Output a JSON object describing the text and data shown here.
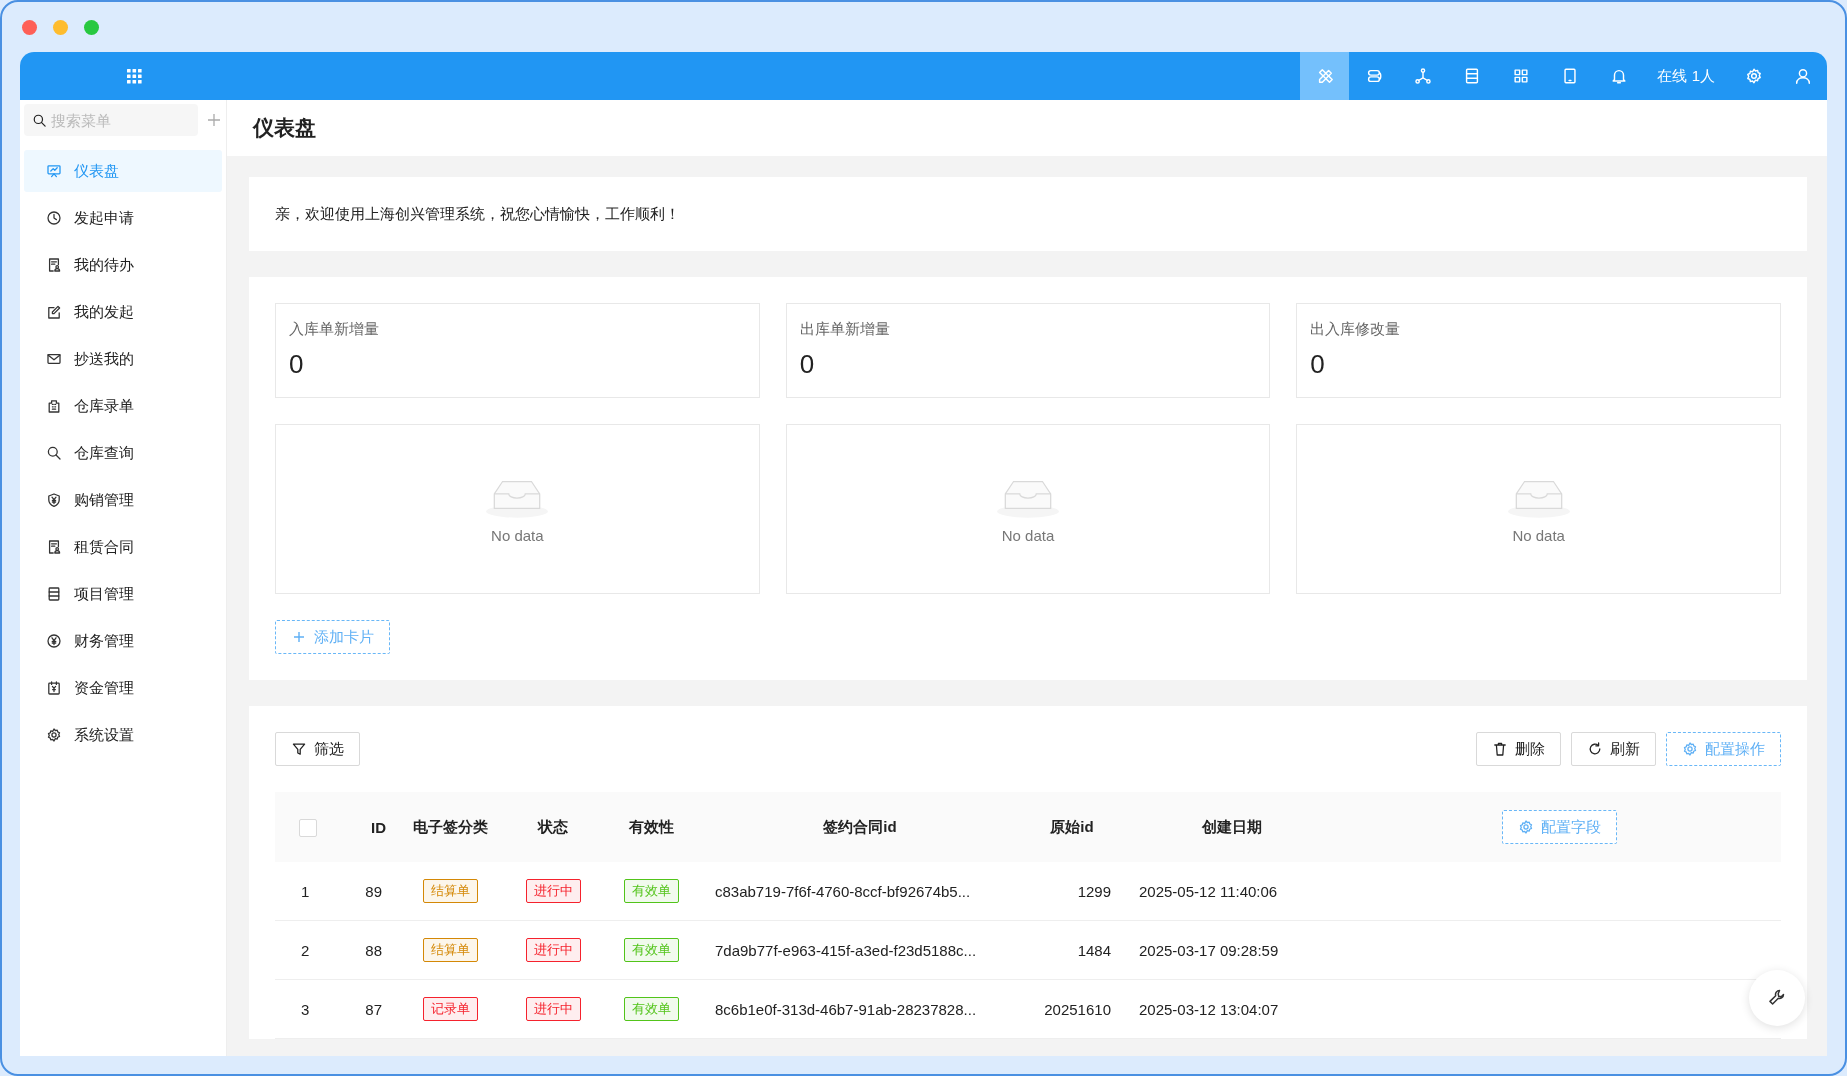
{
  "top_bar": {
    "items": [
      {
        "kind": "icon",
        "selected": true
      },
      {
        "kind": "icon",
        "selected": false
      },
      {
        "kind": "icon",
        "selected": false
      },
      {
        "kind": "icon",
        "selected": false
      },
      {
        "kind": "icon",
        "selected": false
      },
      {
        "kind": "icon",
        "selected": false
      },
      {
        "kind": "icon",
        "selected": false
      },
      {
        "kind": "text",
        "text": "在线 1人",
        "selected": false
      },
      {
        "kind": "icon",
        "selected": false
      },
      {
        "kind": "icon",
        "selected": false
      }
    ]
  },
  "sidebar": {
    "search": {
      "placeholder": "搜索菜单"
    },
    "items": [
      {
        "label": "仪表盘",
        "selected": true
      },
      {
        "label": "发起申请",
        "selected": false
      },
      {
        "label": "我的待办",
        "selected": false
      },
      {
        "label": "我的发起",
        "selected": false
      },
      {
        "label": "抄送我的",
        "selected": false
      },
      {
        "label": "仓库录单",
        "selected": false
      },
      {
        "label": "仓库查询",
        "selected": false
      },
      {
        "label": "购销管理",
        "selected": false
      },
      {
        "label": "租赁合同",
        "selected": false
      },
      {
        "label": "项目管理",
        "selected": false
      },
      {
        "label": "财务管理",
        "selected": false
      },
      {
        "label": "资金管理",
        "selected": false
      },
      {
        "label": "系统设置",
        "selected": false
      }
    ]
  },
  "page_title": "仪表盘",
  "welcome": "亲，欢迎使用上海创兴管理系统，祝您心情愉快，工作顺利！",
  "stats": [
    {
      "label": "入库单新增量",
      "value": "0"
    },
    {
      "label": "出库单新增量",
      "value": "0"
    },
    {
      "label": "出入库修改量",
      "value": "0"
    }
  ],
  "charts": [
    {
      "empty_text": "No data"
    },
    {
      "empty_text": "No data"
    },
    {
      "empty_text": "No data"
    }
  ],
  "add_card_button": "添加卡片",
  "table": {
    "filter_button": "筛选",
    "actions": [
      {
        "label": "删除",
        "kind": "plain"
      },
      {
        "label": "刷新",
        "kind": "plain"
      },
      {
        "label": "配置操作",
        "kind": "dashed"
      }
    ],
    "select_all": {
      "checked": false
    },
    "columns": [
      "ID",
      "电子签分类",
      "状态",
      "有效性",
      "签约合同id",
      "原始id",
      "创建日期"
    ],
    "config_fields_button": "配置字段",
    "rows": [
      {
        "index": "1",
        "id": "89",
        "category": {
          "text": "结算单",
          "color": "#d48806"
        },
        "status": {
          "text": "进行中",
          "color": "#f5222d"
        },
        "validity": {
          "text": "有效单",
          "color": "#52c41a"
        },
        "contract_id": "c83ab719-7f6f-4760-8ccf-bf92674b5...",
        "original_id": "1299",
        "created": "2025-05-12 11:40:06"
      },
      {
        "index": "2",
        "id": "88",
        "category": {
          "text": "结算单",
          "color": "#d48806"
        },
        "status": {
          "text": "进行中",
          "color": "#f5222d"
        },
        "validity": {
          "text": "有效单",
          "color": "#52c41a"
        },
        "contract_id": "7da9b77f-e963-415f-a3ed-f23d5188c...",
        "original_id": "1484",
        "created": "2025-03-17 09:28:59"
      },
      {
        "index": "3",
        "id": "87",
        "category": {
          "text": "记录单",
          "color": "#f5222d"
        },
        "status": {
          "text": "进行中",
          "color": "#f5222d"
        },
        "validity": {
          "text": "有效单",
          "color": "#52c41a"
        },
        "contract_id": "8c6b1e0f-313d-46b7-91ab-28237828...",
        "original_id": "20251610",
        "created": "2025-03-12 13:04:07"
      }
    ]
  }
}
